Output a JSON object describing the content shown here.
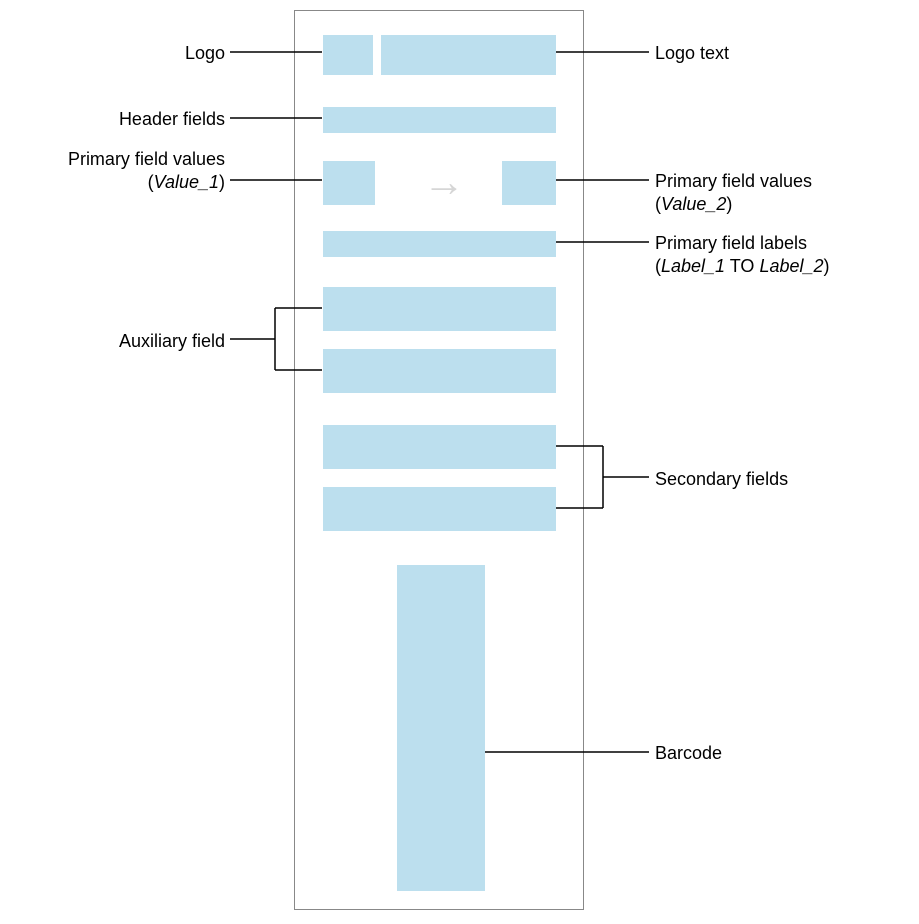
{
  "labels": {
    "logo": "Logo",
    "logo_text": "Logo text",
    "header_fields": "Header fields",
    "primary_value1_line1": "Primary field values",
    "primary_value1_line2_open": "(",
    "primary_value1_line2_val": "Value_1",
    "primary_value1_line2_close": ")",
    "primary_value2_line1": "Primary field values",
    "primary_value2_line2_open": "(",
    "primary_value2_line2_val": "Value_2",
    "primary_value2_line2_close": ")",
    "primary_labels_line1": "Primary field labels",
    "primary_labels_line2_open": "(",
    "primary_labels_line2_l1": "Label_1",
    "primary_labels_line2_to": " TO ",
    "primary_labels_line2_l2": "Label_2",
    "primary_labels_line2_close": ")",
    "auxiliary_field": "Auxiliary field",
    "secondary_fields": "Secondary fields",
    "barcode": "Barcode"
  }
}
